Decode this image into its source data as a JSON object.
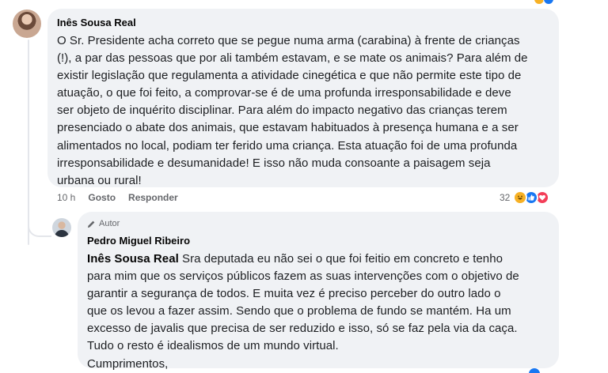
{
  "comment1": {
    "author": "Inês Sousa Real",
    "lines": [
      "O Sr. Presidente acha correto que se pegue numa arma (carabina) à frente de crianças",
      "(!), a par das pessoas que por ali também estavam, e se mate os animais? Para além de",
      "existir legislação que regulamenta a atividade cinegética e que não permite este tipo de",
      "atuação, o que foi feito, a comprovar-se é de uma profunda irresponsabilidade e deve",
      "ser objeto de inquérito disciplinar. Para além do impacto negativo das crianças terem",
      "presenciado o abate dos animais, que estavam habituados à presença humana e a ser",
      "alimentados no local, podiam ter ferido uma criança. Esta atuação foi de uma profunda",
      "irresponsabilidade e desumanidade! E isso não muda consoante a paisagem seja",
      "urbana ou rural!"
    ],
    "time": "10 h",
    "like_label": "Gosto",
    "reply_label": "Responder",
    "reaction_count": "32",
    "reactions": [
      "haha-icon",
      "like-icon",
      "love-icon"
    ]
  },
  "comment2": {
    "badge": "Autor",
    "author": "Pedro Miguel Ribeiro",
    "mention": "Inês Sousa Real",
    "first_line_rest": " Sra deputada eu não sei o que foi feitio em concreto e tenho",
    "lines": [
      "para mim que os serviços públicos fazem as suas intervenções com o objetivo de",
      "garantir a segurança de todos. E muita vez é preciso perceber do outro lado o",
      "que os levou a fazer assim. Sendo que o problema de fundo se mantém. Ha um",
      "excesso de javalis que precisa de ser reduzido e isso, só se faz pela via da caça.",
      "Tudo o resto é idealismos de um mundo virtual.",
      "Cumprimentos,"
    ]
  },
  "colors": {
    "bubble": "#f0f2f5",
    "secondary_text": "#65676b",
    "like": "#1877f2",
    "love": "#f33e58",
    "haha": "#f7b125"
  }
}
